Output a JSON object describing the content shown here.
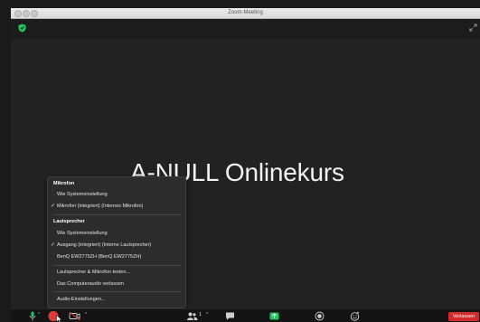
{
  "window": {
    "title": "Zoom-Meeting"
  },
  "meeting": {
    "shared_title": "A-NULL Onlinekurs"
  },
  "audio_menu": {
    "microphone_header": "Mikrofon",
    "microphone_items": [
      {
        "label": "Wie Systemeinstellung",
        "checked": false
      },
      {
        "label": "Mikrofon (integriert) (Internes Mikrofon)",
        "checked": true
      }
    ],
    "speaker_header": "Lautsprecher",
    "speaker_items": [
      {
        "label": "Wie Systemeinstellung",
        "checked": false
      },
      {
        "label": "Ausgang (integriert) (Interne Lautsprecher)",
        "checked": true
      },
      {
        "label": "BenQ EW2775ZH (BenQ EW2775ZH)",
        "checked": false
      }
    ],
    "test_label": "Lautsprecher & Mikrofon testen...",
    "leave_audio_label": "Das Computeraudio verlassen",
    "settings_label": "Audio-Einstellungen...",
    "check_mark": "✓"
  },
  "toolbar": {
    "participants_count": "1",
    "leave_label": "Verlassen"
  },
  "colors": {
    "accent_green": "#22c55e",
    "leave_red": "#d32b2b",
    "record_red": "#e03b3b",
    "background": "#222222"
  }
}
